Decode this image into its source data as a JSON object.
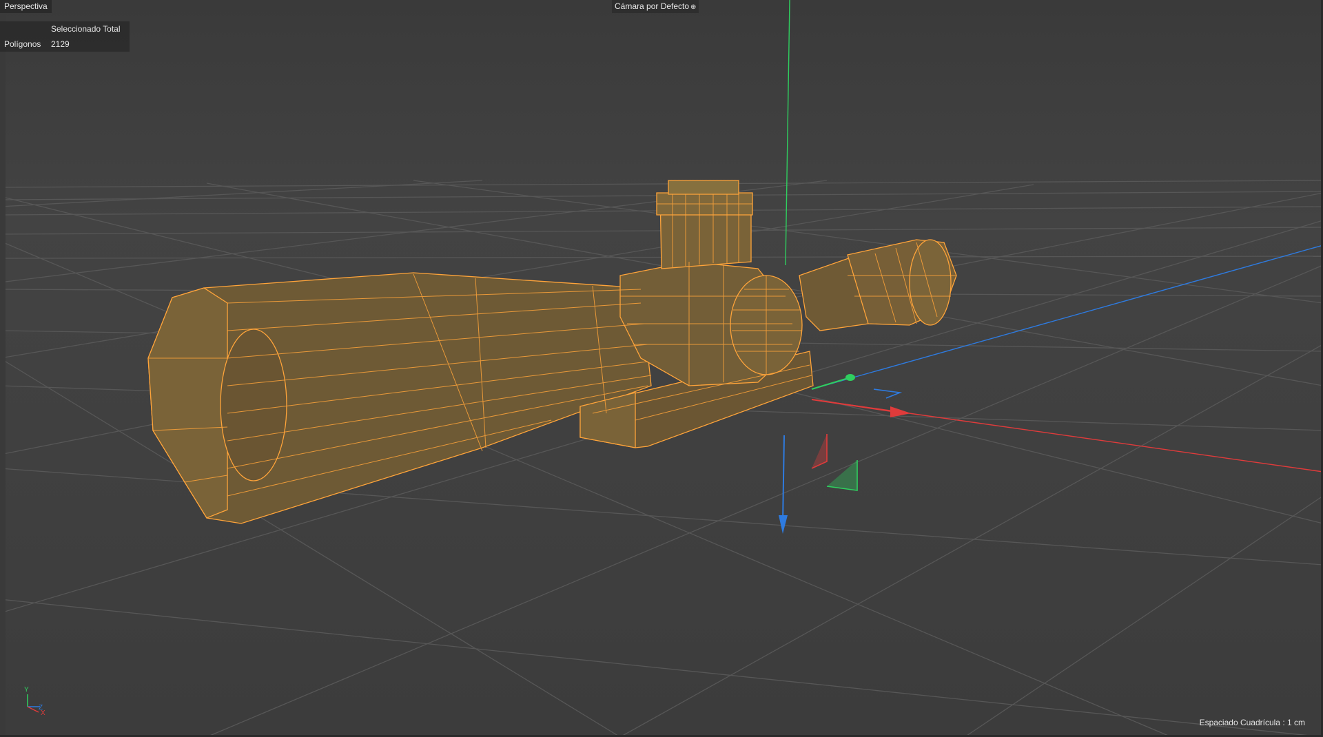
{
  "viewport": {
    "view_name": "Perspectiva",
    "camera_label": "Cámara por Defecto",
    "camera_icon": "camera-orbit-icon"
  },
  "hud": {
    "header": "Seleccionado Total",
    "rows": [
      {
        "label": "Polígonos",
        "value": "2129"
      }
    ]
  },
  "status": {
    "grid_spacing": "Espaciado Cuadrícula : 1 cm"
  },
  "axis_indicator": {
    "y": "Y",
    "z": "Z",
    "x": "X"
  },
  "colors": {
    "background": "#404040",
    "grid_line": "#5a5a5a",
    "model_fill": "#6e5a35",
    "model_wire": "#ffa43a",
    "axis_x": "#e03b3b",
    "axis_y": "#2fcf5f",
    "axis_z": "#2e7be0"
  },
  "scene": {
    "object": "rifle-scope-mesh",
    "selection_mode": "polygon"
  }
}
